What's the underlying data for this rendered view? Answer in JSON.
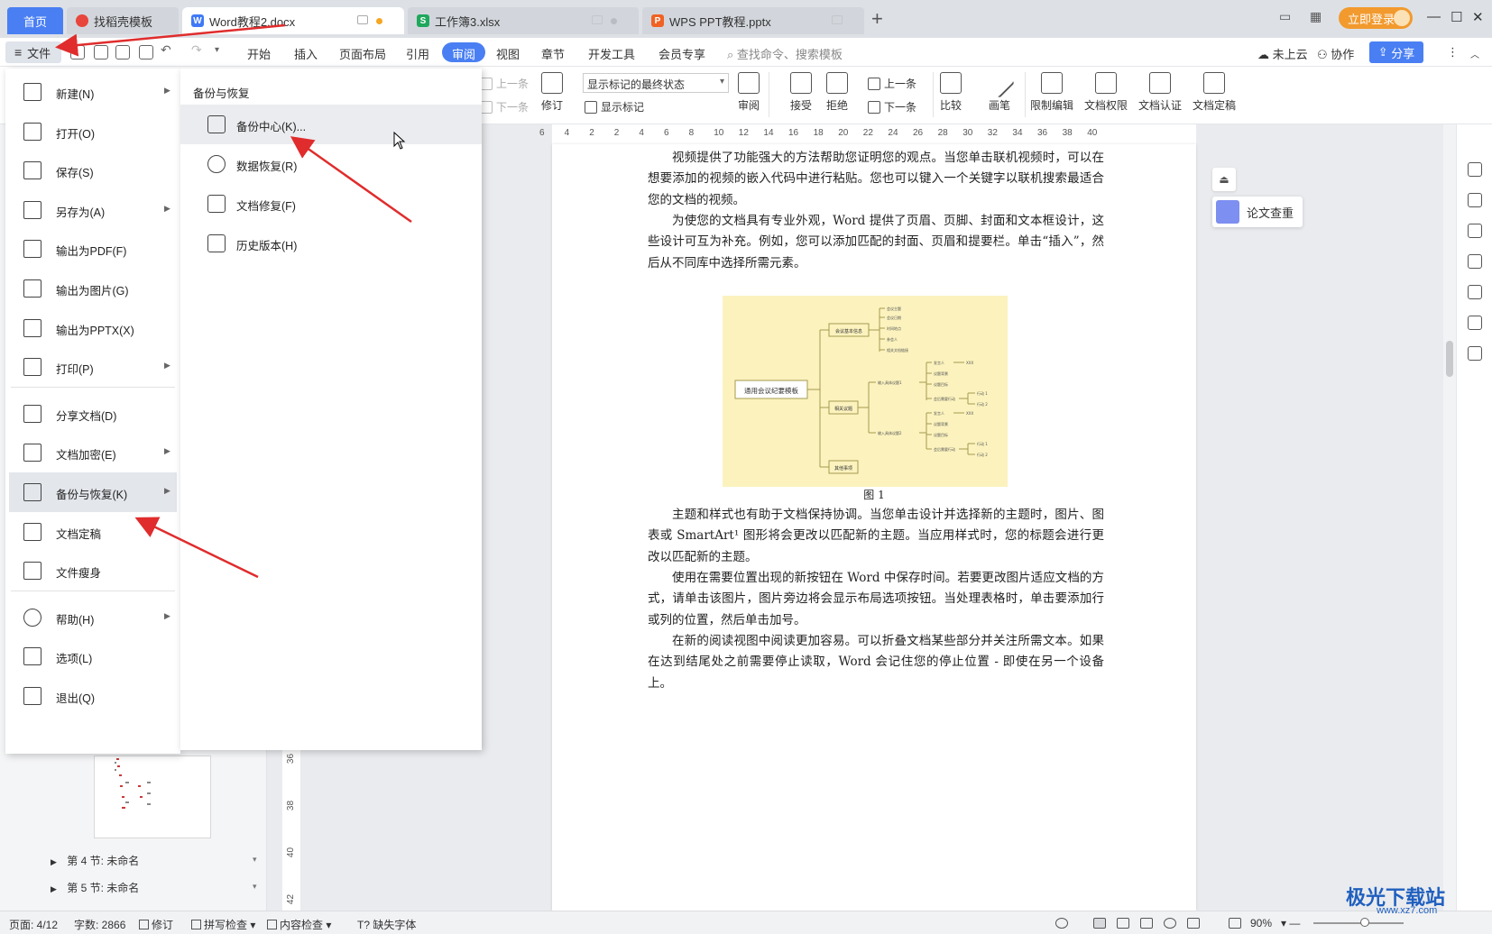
{
  "titlebar": {
    "home_tab": "首页",
    "tabs": [
      {
        "label": "找稻壳模板",
        "icon_color": "#e8453c"
      },
      {
        "label": "Word教程2.docx",
        "icon_color": "#3f79f6",
        "icon_letter": "W",
        "dot_color": "#f5a623"
      },
      {
        "label": "工作簿3.xlsx",
        "icon_color": "#1fa85c",
        "icon_letter": "S"
      },
      {
        "label": "WPS PPT教程.pptx",
        "icon_color": "#f06223",
        "icon_letter": "P"
      }
    ],
    "new_tab": "+",
    "login_label": "立即登录",
    "win_buttons": [
      "—",
      "☐",
      "✕"
    ]
  },
  "menubar": {
    "file_label": "文件",
    "tabs": [
      "开始",
      "插入",
      "页面布局",
      "引用",
      "审阅",
      "视图",
      "章节",
      "开发工具",
      "会员专享"
    ],
    "active_tab": "审阅",
    "search_placeholder": "查找命令、搜索模板",
    "cloud_label": "未上云",
    "collab_label": "协作",
    "share_label": "分享"
  },
  "ribbon": {
    "prev_item": "上一条",
    "next_item": "下一条",
    "revise_label": "修订",
    "mark_state": "显示标记的最终状态",
    "show_marks": "显示标记",
    "review_label": "审阅",
    "accept_label": "接受",
    "reject_label": "拒绝",
    "prev_item2": "上一条",
    "next_item2": "下一条",
    "compare_label": "比较",
    "pen_label": "画笔",
    "restrict_label": "限制编辑",
    "perm_label": "文档权限",
    "cert_label": "文档认证",
    "final_label": "文档定稿"
  },
  "ruler": {
    "ticks": [
      "6",
      "4",
      "2",
      "2",
      "4",
      "6",
      "8",
      "10",
      "12",
      "14",
      "16",
      "18",
      "20",
      "22",
      "24",
      "26",
      "28",
      "30",
      "32",
      "34",
      "36",
      "38",
      "40"
    ]
  },
  "file_menu": {
    "items": [
      {
        "label": "新建(N)",
        "arrow": true
      },
      {
        "label": "打开(O)",
        "arrow": false
      },
      {
        "label": "保存(S)",
        "arrow": false
      },
      {
        "label": "另存为(A)",
        "arrow": true
      },
      {
        "label": "输出为PDF(F)",
        "arrow": false
      },
      {
        "label": "输出为图片(G)",
        "arrow": false
      },
      {
        "label": "输出为PPTX(X)",
        "arrow": false
      },
      {
        "label": "打印(P)",
        "arrow": true
      },
      {
        "label": "分享文档(D)",
        "arrow": false
      },
      {
        "label": "文档加密(E)",
        "arrow": true
      },
      {
        "label": "备份与恢复(K)",
        "arrow": true
      },
      {
        "label": "文档定稿",
        "arrow": false
      },
      {
        "label": "文件瘦身",
        "arrow": false
      },
      {
        "label": "帮助(H)",
        "arrow": true
      },
      {
        "label": "选项(L)",
        "arrow": false
      },
      {
        "label": "退出(Q)",
        "arrow": false
      }
    ],
    "selected": "备份与恢复(K)"
  },
  "submenu": {
    "title": "备份与恢复",
    "items": [
      "备份中心(K)...",
      "数据恢复(R)",
      "文档修复(F)",
      "历史版本(H)"
    ]
  },
  "nav": {
    "sections": [
      "第 4 节: 未命名",
      "第 5 节: 未命名"
    ],
    "vruler": [
      "36",
      "38",
      "40",
      "42"
    ]
  },
  "document": {
    "paragraphs": [
      "视频提供了功能强大的方法帮助您证明您的观点。当您单击联机视频时，可以在想要添加的视频的嵌入代码中进行粘贴。您也可以键入一个关键字以联机搜索最适合您的文档的视频。",
      "为使您的文档具有专业外观，Word 提供了页眉、页脚、封面和文本框设计，这些设计可互为补充。例如，您可以添加匹配的封面、页眉和提要栏。单击“插入”，然后从不同库中选择所需元素。",
      "主题和样式也有助于文档保持协调。当您单击设计并选择新的主题时，图片、图表或 SmartArt¹ 图形将会更改以匹配新的主题。当应用样式时，您的标题会进行更改以匹配新的主题。",
      "使用在需要位置出现的新按钮在 Word 中保存时间。若要更改图片适应文档的方式，请单击该图片，图片旁边将会显示布局选项按钮。当处理表格时，单击要添加行或列的位置，然后单击加号。",
      "在新的阅读视图中阅读更加容易。可以折叠文档某些部分并关注所需文本。如果在达到结尾处之前需要停止读取，Word 会记住您的停止位置 - 即使在另一个设备上。"
    ],
    "figure_caption": "图 1",
    "mindmap": {
      "root": "通用会议纪要模板",
      "branches": [
        "会议基本信息",
        "相关议题",
        "其他事项"
      ],
      "leaves1": [
        "会议主题",
        "会议日期",
        "时间地点",
        "参会人",
        "相关文档链接"
      ],
      "sub": [
        "输入具体议题1",
        "输入具体议题2"
      ],
      "subleaves": [
        "发言人",
        "议题背景",
        "议题目标",
        "会后需要行动"
      ],
      "xxx": "XXX",
      "actions": [
        "行动 1",
        "行动 2"
      ]
    }
  },
  "right_panel": {
    "thesis_check": "论文查重"
  },
  "statusbar": {
    "page": "页面: 4/12",
    "words": "字数: 2866",
    "revise": "修订",
    "spell": "拼写检查",
    "content_check": "内容检查",
    "missing_font": "缺失字体",
    "zoom": "90%"
  },
  "watermark": {
    "brand": "极光下载站",
    "url": "www.xz7.com"
  }
}
